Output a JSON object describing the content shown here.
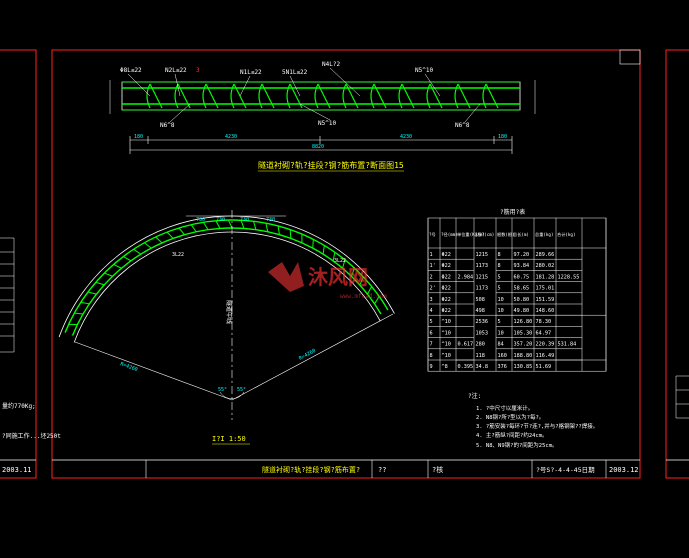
{
  "colors": {
    "background": "#000000",
    "frame": "#ff0000",
    "rebar": "#00ff00",
    "text": "#ffffff",
    "label": "#ffff00",
    "dimension": "#00ffff",
    "watermark": "#e03030"
  },
  "section_title": "隧道衬砌?轨?挂段?钢?筋布置?断面图15",
  "top_callouts": [
    "Φ8L≤22",
    "N2L≤22",
    "3",
    "N1L≤22",
    "5N1L≤22",
    "N4L?2",
    "N5^10"
  ],
  "top_labels_bottom": [
    "N6^8",
    "N5^10",
    "N6^8"
  ],
  "top_dims": [
    "180",
    "4230",
    "4230",
    "180",
    "8820"
  ],
  "top_dim_total": "8820",
  "arc_dims": [
    "730",
    "730",
    "730",
    "730"
  ],
  "arc_labels": {
    "left_label": "3L22",
    "right_label": "3L22",
    "left_radius": "R=4260",
    "right_radius": "R=4260",
    "left_angle": "55°",
    "right_angle": "55°",
    "axis_label": "隧道中线"
  },
  "section_scale_label": "I?I 1:50",
  "table": {
    "title": "?筋用?表",
    "headers": [
      "?号",
      "?径(mm)",
      "单位重(Kg/m)",
      "?根?(cm)",
      "根数(根)",
      "总长(m)",
      "总重(kg)",
      "合计(kg)"
    ],
    "rows": [
      [
        "1",
        "Φ22",
        "",
        "1215",
        "8",
        "97.20",
        "289.66",
        ""
      ],
      [
        "1'",
        "Φ22",
        "",
        "1173",
        "8",
        "93.84",
        "280.02",
        ""
      ],
      [
        "2",
        "Φ22",
        "2.984",
        "1215",
        "5",
        "60.75",
        "181.28",
        "1228.55"
      ],
      [
        "2'",
        "Φ22",
        "",
        "1173",
        "5",
        "58.65",
        "175.01",
        ""
      ],
      [
        "3",
        "Φ22",
        "",
        "508",
        "10",
        "50.80",
        "151.59",
        ""
      ],
      [
        "4",
        "Φ22",
        "",
        "498",
        "10",
        "49.80",
        "148.60",
        ""
      ],
      [
        "5",
        "^10",
        "",
        "2536",
        "5",
        "126.80",
        "78.30",
        ""
      ],
      [
        "6",
        "^10",
        "",
        "1053",
        "10",
        "105.30",
        "64.97",
        ""
      ],
      [
        "7",
        "^10",
        "0.617",
        "280",
        "84",
        "357.20",
        "220.39",
        "531.84"
      ],
      [
        "8",
        "^10",
        "",
        "118",
        "160",
        "188.80",
        "116.49",
        ""
      ],
      [
        "9",
        "^8",
        "0.395",
        "34.8",
        "376",
        "130.85",
        "51.69",
        ""
      ]
    ]
  },
  "notes": {
    "heading": "?注:",
    "items": [
      "1. ?中尺寸以厘米计。",
      "2. N8钢?所?型以为?每?。",
      "3. ?筋安装?每环?节?连?,并与?格钢架??焊接。",
      "4. 主?筋纵?间距?约24cm。",
      "5. N8、N9钢?的?间距为25cm。"
    ]
  },
  "title_block": {
    "drawing_name": "隧道衬砌?轨?挂段?钢?筋布置?",
    "col_a": "??",
    "col_b": "?核",
    "drawing_no": "?号S?-4-4-45日期",
    "date": "2003.12"
  },
  "left_panel": {
    "weight_note": "量约770Kg;",
    "work_note": "?同施工作...坯250t",
    "date": "2003.11"
  },
  "watermark": "沐风网",
  "watermark_url": "www.mfcad.com"
}
